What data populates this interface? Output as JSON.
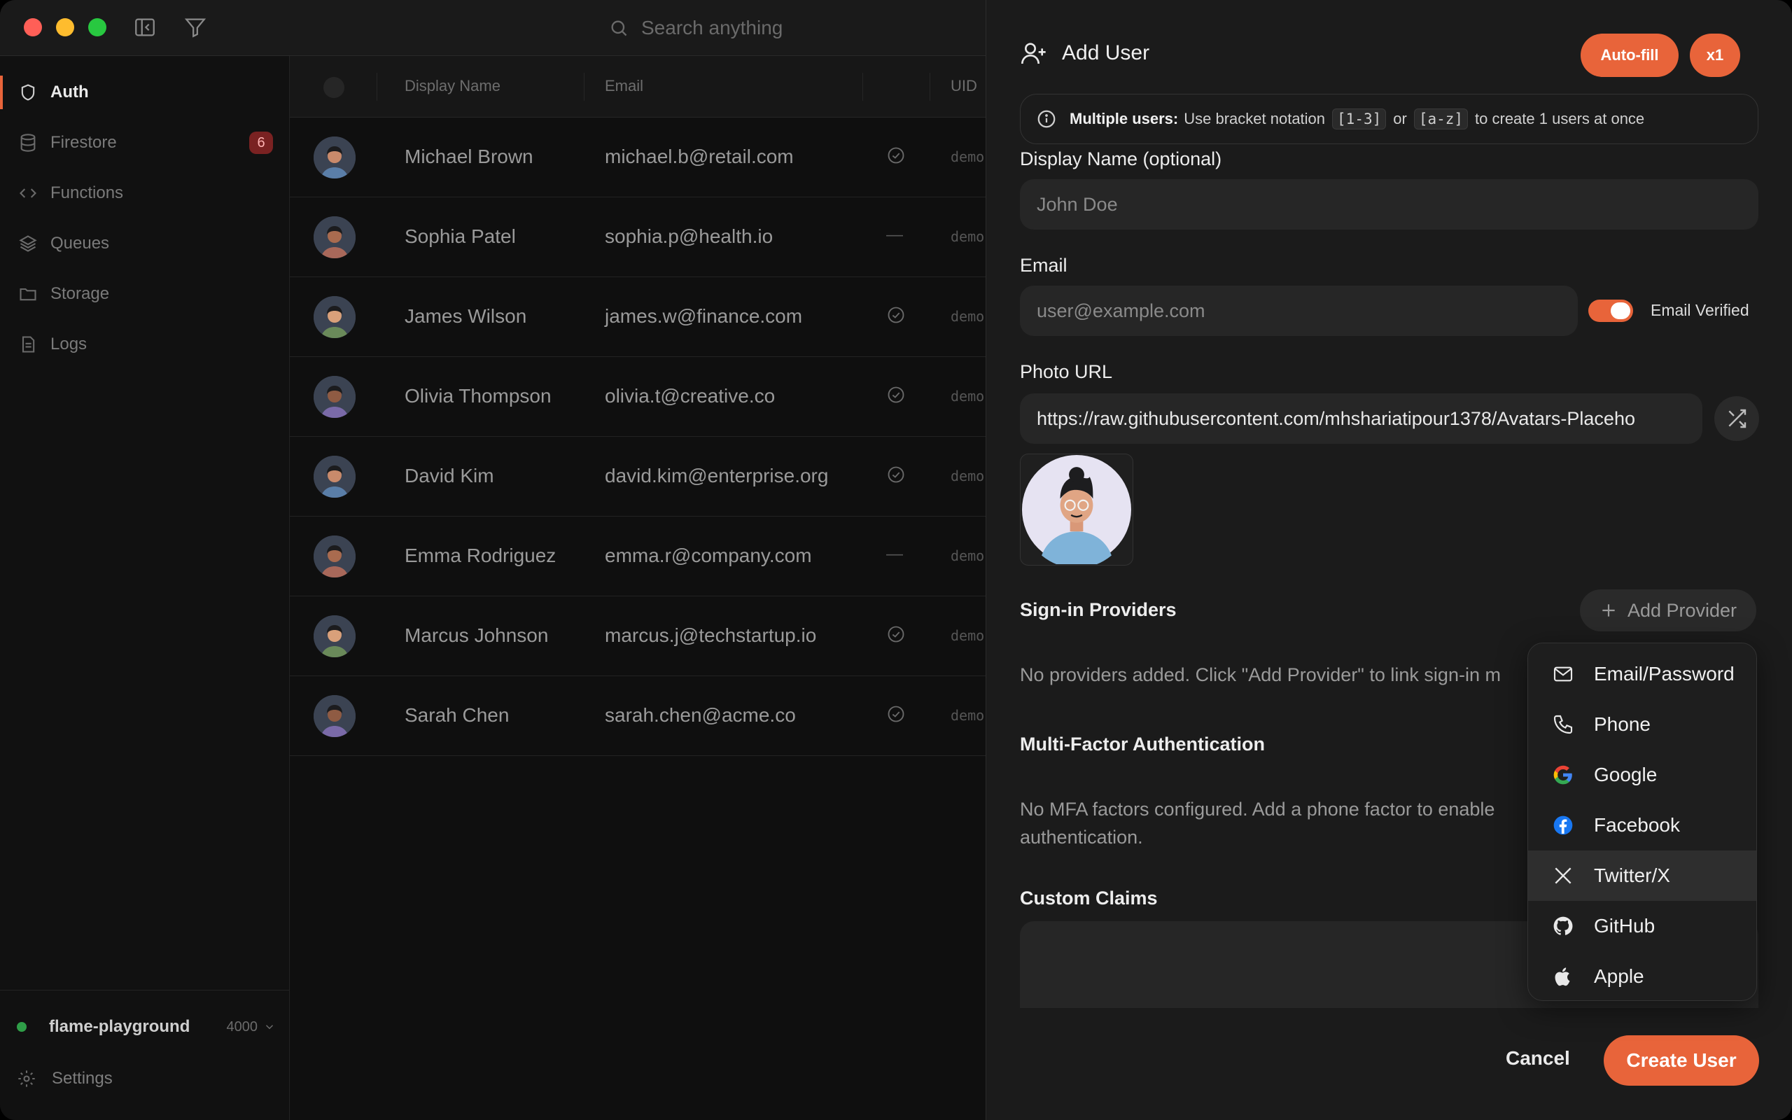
{
  "titlebar": {
    "search_placeholder": "Search anything"
  },
  "sidebar": {
    "items": [
      {
        "label": "Auth",
        "icon": "shield-icon",
        "active": true
      },
      {
        "label": "Firestore",
        "icon": "database-icon",
        "badge": "6"
      },
      {
        "label": "Functions",
        "icon": "code-icon"
      },
      {
        "label": "Queues",
        "icon": "layers-icon"
      },
      {
        "label": "Storage",
        "icon": "folder-icon"
      },
      {
        "label": "Logs",
        "icon": "file-text-icon"
      }
    ],
    "project": {
      "name": "flame-playground",
      "port": "4000"
    },
    "settings_label": "Settings"
  },
  "table": {
    "columns": [
      "Display Name",
      "Email",
      "UID"
    ],
    "rows": [
      {
        "name": "Michael Brown",
        "email": "michael.b@retail.com",
        "verified": true,
        "uid": "demo"
      },
      {
        "name": "Sophia Patel",
        "email": "sophia.p@health.io",
        "verified": false,
        "uid": "demo"
      },
      {
        "name": "James Wilson",
        "email": "james.w@finance.com",
        "verified": true,
        "uid": "demo"
      },
      {
        "name": "Olivia Thompson",
        "email": "olivia.t@creative.co",
        "verified": true,
        "uid": "demo"
      },
      {
        "name": "David Kim",
        "email": "david.kim@enterprise.org",
        "verified": true,
        "uid": "demo"
      },
      {
        "name": "Emma Rodriguez",
        "email": "emma.r@company.com",
        "verified": false,
        "uid": "demo"
      },
      {
        "name": "Marcus Johnson",
        "email": "marcus.j@techstartup.io",
        "verified": true,
        "uid": "demo"
      },
      {
        "name": "Sarah Chen",
        "email": "sarah.chen@acme.co",
        "verified": true,
        "uid": "demo"
      }
    ],
    "unverified_mark": "—"
  },
  "dialog": {
    "title": "Add User",
    "autofill_label": "Auto-fill",
    "count_label": "x1",
    "info": {
      "bold": "Multiple users:",
      "text1": "Use bracket notation",
      "code1": "[1-3]",
      "text2": "or",
      "code2": "[a-z]",
      "text3": "to create 1 users at once"
    },
    "display_name": {
      "label": "Display Name (optional)",
      "placeholder": "John Doe"
    },
    "email": {
      "label": "Email",
      "placeholder": "user@example.com",
      "verified_label": "Email Verified",
      "verified": true
    },
    "photo": {
      "label": "Photo URL",
      "value": "https://raw.githubusercontent.com/mhshariatipour1378/Avatars-Placeho"
    },
    "providers": {
      "label": "Sign-in Providers",
      "add_label": "Add Provider",
      "empty_text": "No providers added. Click \"Add Provider\" to link sign-in m"
    },
    "mfa": {
      "label": "Multi-Factor Authentication",
      "empty_text": "No MFA factors configured. Add a phone factor to enable authentication."
    },
    "claims": {
      "label": "Custom Claims"
    },
    "cancel_label": "Cancel",
    "create_label": "Create User"
  },
  "provider_menu": {
    "items": [
      {
        "label": "Email/Password",
        "icon": "mail-icon"
      },
      {
        "label": "Phone",
        "icon": "phone-icon"
      },
      {
        "label": "Google",
        "icon": "google-icon"
      },
      {
        "label": "Facebook",
        "icon": "facebook-icon"
      },
      {
        "label": "Twitter/X",
        "icon": "x-icon",
        "highlighted": true
      },
      {
        "label": "GitHub",
        "icon": "github-icon"
      },
      {
        "label": "Apple",
        "icon": "apple-icon"
      }
    ]
  },
  "colors": {
    "accent": "#e8643a",
    "background": "#141414",
    "panel": "#1b1b1b"
  }
}
